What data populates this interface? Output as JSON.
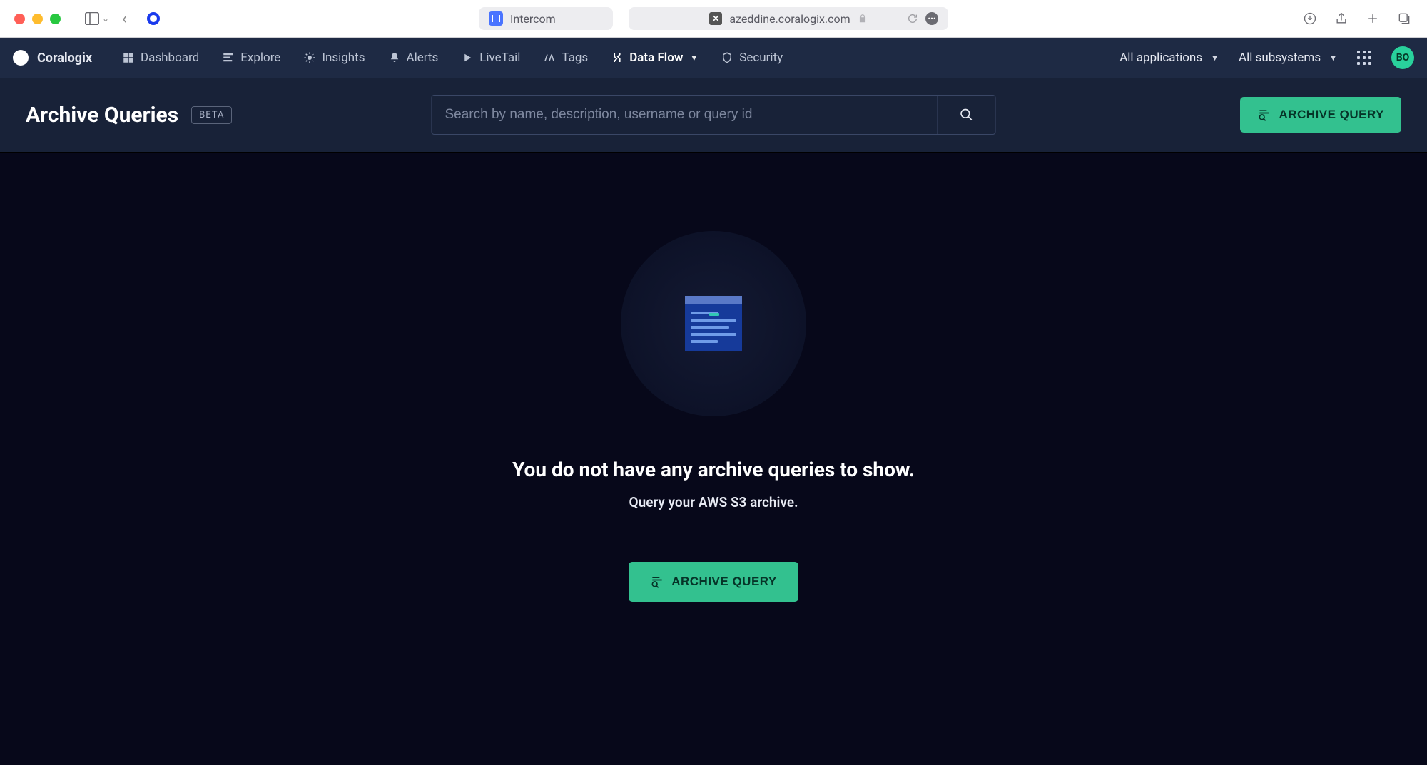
{
  "browser": {
    "tab1_label": "Intercom",
    "url": "azeddine.coralogix.com"
  },
  "nav": {
    "brand": "Coralogix",
    "links": {
      "dashboard": "Dashboard",
      "explore": "Explore",
      "insights": "Insights",
      "alerts": "Alerts",
      "livetail": "LiveTail",
      "tags": "Tags",
      "dataflow": "Data Flow",
      "security": "Security"
    },
    "all_apps": "All applications",
    "all_subsys": "All subsystems",
    "avatar": "BO"
  },
  "subheader": {
    "title": "Archive Queries",
    "badge": "BETA",
    "search_placeholder": "Search by name, description, username or query id",
    "archive_btn": "ARCHIVE QUERY"
  },
  "empty": {
    "title": "You do not have any archive queries to show.",
    "subtitle": "Query your AWS S3 archive.",
    "cta": "ARCHIVE QUERY"
  }
}
